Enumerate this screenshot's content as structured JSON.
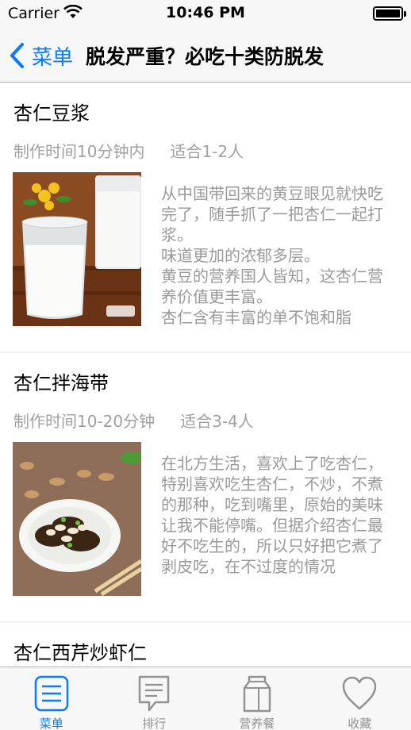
{
  "status_bar": {
    "carrier": "Carrier",
    "time": "10:46 PM"
  },
  "nav": {
    "back_label": "菜单",
    "title": "脱发严重？必吃十类防脱发"
  },
  "recipes": [
    {
      "name": "杏仁豆浆",
      "time": "制作时间10分钟内",
      "servings": "适合1-2人",
      "description": [
        "从中国带回来的黄豆眼见就快吃完了，随手抓了一把杏仁一起打浆。",
        "味道更加的浓郁多层。",
        "黄豆的营养国人皆知，这杏仁营养价值更丰富。",
        "杏仁含有丰富的单不饱和脂"
      ]
    },
    {
      "name": "杏仁拌海带",
      "time": "制作时间10-20分钟",
      "servings": "适合3-4人",
      "description": [
        "在北方生活，喜欢上了吃杏仁，特别喜欢吃生杏仁，不炒，不煮的那种，吃到嘴里，原始的美味让我不能停嘴。但据介绍杏仁最好不吃生的，所以只好把它煮了剥皮吃，在不过度的情况"
      ]
    },
    {
      "name": "杏仁西芹炒虾仁",
      "time": "",
      "servings": "",
      "description": []
    }
  ],
  "tabs": [
    {
      "label": "菜单",
      "icon": "menu-list-icon",
      "active": true
    },
    {
      "label": "排行",
      "icon": "ranking-chat-icon",
      "active": false
    },
    {
      "label": "营养餐",
      "icon": "milk-carton-icon",
      "active": false
    },
    {
      "label": "收藏",
      "icon": "heart-icon",
      "active": false
    }
  ],
  "colors": {
    "accent": "#0a7aff",
    "inactive": "#929292",
    "meta_text": "#a0a0a0"
  }
}
